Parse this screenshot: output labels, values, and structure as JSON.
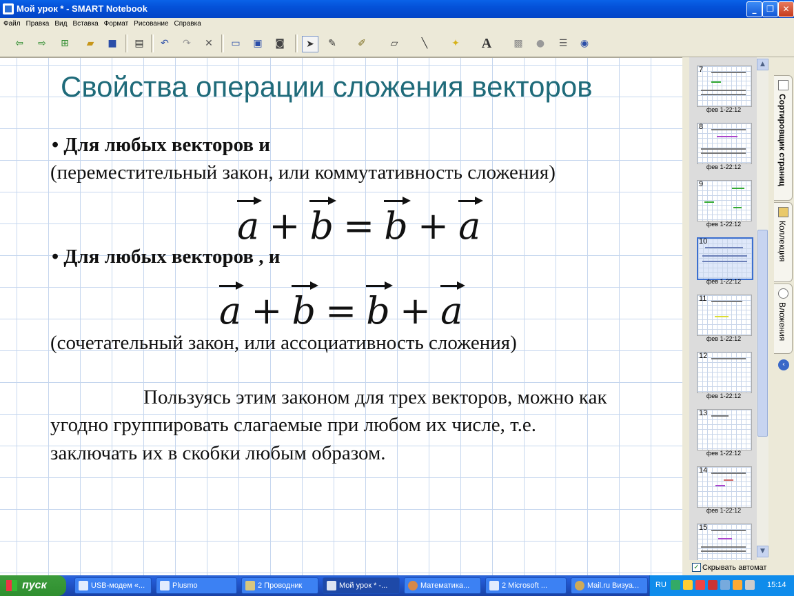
{
  "window": {
    "title": "Мой урок * - SMART Notebook",
    "buttons": {
      "minimize": "_",
      "restore": "❐",
      "close": "✕"
    }
  },
  "menu": [
    "Файл",
    "Правка",
    "Вид",
    "Вставка",
    "Формат",
    "Рисование",
    "Справка"
  ],
  "toolbar": {
    "icons": [
      "back-icon",
      "forward-icon",
      "add-page-icon",
      "open-icon",
      "save-icon",
      "paste-icon",
      "undo-icon",
      "redo-icon",
      "delete-icon",
      "screen-shade-icon",
      "full-screen-icon",
      "capture-icon",
      "select-icon",
      "pen-icon",
      "creative-pen-icon",
      "eraser-icon",
      "line-icon",
      "magic-pen-icon",
      "text-icon",
      "fill-icon",
      "shapes-icon",
      "table-icon",
      "more-icon"
    ]
  },
  "slide": {
    "title": "Свойства операции сложения векторов",
    "line1": "• Для любых векторов       и",
    "line2": "(переместительный закон, или коммутативность сложения)",
    "line3": "•   Для любых векторов         ,       и",
    "line4": "(сочетательный закон, или ассоциативность сложения)",
    "para1": "Пользуясь этим законом для трех векторов, можно как",
    "para2": "угодно группировать слагаемые при любом их числе, т.е.",
    "para3": "заключать их в скобки любым образом.",
    "formula1": {
      "a": "a",
      "plus": "+",
      "b": "b",
      "eq": "="
    },
    "formula2": {
      "a": "a",
      "plus": "+",
      "b": "b",
      "eq": "="
    }
  },
  "pages": [
    {
      "num": "7",
      "date": "фев 1-22:12"
    },
    {
      "num": "8",
      "date": "фев 1-22:12"
    },
    {
      "num": "9",
      "date": "фев 1-22:12"
    },
    {
      "num": "10",
      "date": "фев 1-22:12"
    },
    {
      "num": "11",
      "date": "фев 1-22:12"
    },
    {
      "num": "12",
      "date": "фев 1-22:12"
    },
    {
      "num": "13",
      "date": "фев 1-22:12"
    },
    {
      "num": "14",
      "date": "фев 1-22:12"
    },
    {
      "num": "15",
      "date": ""
    }
  ],
  "autohide_label": "Скрывать автомат",
  "side_tabs": [
    "Сортировщик страниц",
    "Коллекция",
    "Вложения"
  ],
  "taskbar": {
    "start": "пуск",
    "tasks": [
      "USB-модем «...",
      "Plusmo",
      "2 Проводник",
      "Мой урок * -...",
      "Математика...",
      "2 Microsoft ...",
      "Mail.ru Визуа..."
    ],
    "lang": "RU",
    "clock": "15:14"
  }
}
